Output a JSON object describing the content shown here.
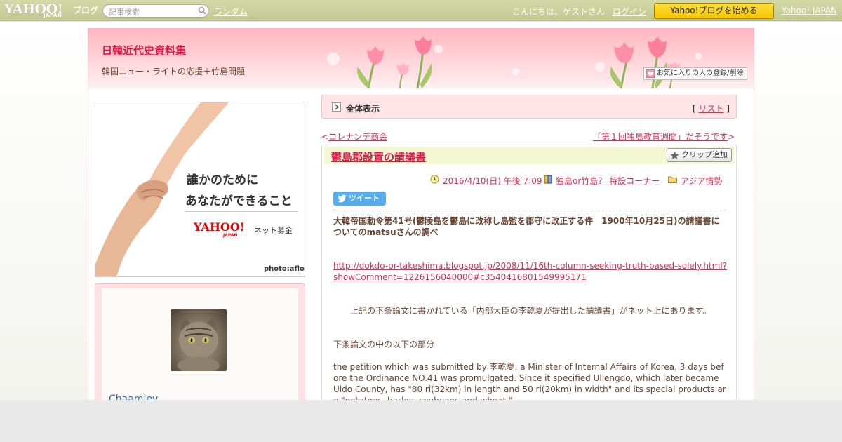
{
  "topbar": {
    "logo_main": "YAHOO!",
    "logo_sub": "JAPAN",
    "logo_blog": "ブログ",
    "search_placeholder": "記事検索",
    "random_label": "ランダム",
    "greeting": "こんにちは、ゲストさん",
    "login_label": "ログイン",
    "start_button": "Yahoo!ブログを始める",
    "yahoo_japan_link": "Yahoo! JAPAN"
  },
  "header": {
    "blog_title": "日韓近代史資料集",
    "blog_description": "韓国ニュー・ライトの応援＋竹島問題",
    "favorite_button": "お気に入りの人の登録/削除"
  },
  "sidebar": {
    "banner": {
      "line1": "誰かのために",
      "line2": "あなたができること",
      "logo": "YAHOO!",
      "logo_sub": "JAPAN",
      "bokin": "ネット募金",
      "credit": "photo:aflo"
    },
    "profile": {
      "name": "Chaamiey"
    }
  },
  "section": {
    "title": "全体表示",
    "list_open": "[ ",
    "list_label": "リスト",
    "list_close": " ]"
  },
  "nav": {
    "prev_arrow": "<",
    "prev_label": "コレナンデ商会",
    "next_label": "「第１回独島教育週間」だそうです",
    "next_arrow": ">"
  },
  "article": {
    "title": "鬱島郡設置の請議書",
    "clip_button": "クリップ追加",
    "date": "2016/4/10(日) 午後 7:09",
    "category": "独島or竹島？ 特設コーナー",
    "folder": "アジア情勢",
    "tweet_button": "ツイート",
    "paragraphs": {
      "p1": "大韓帝国勅令第41号(鬱陵島を鬱島に改称し島監を郡守に改正する件　1900年10月25日)の請議書についてのmatsuさんの調べ",
      "p2": "http://dokdo-or-takeshima.blogspot.jp/2008/11/16th-column-seeking-truth-based-solely.html?showComment=1226156040000#c3540416801549995171",
      "p3": "上記の下条論文に書かれている「内部大臣の李乾夏が提出した請議書」がネット上にあります。",
      "p4": "下条論文の中の以下の部分",
      "p5": "the petition which was submitted by 李乾夏, a Minister of Internal Affairs of Korea, 3 days before the Ordinance NO.41 was promulgated. Since it specified Ullengdo, which later became Uldo County, has \"80 ri(32km) in length and 50 ri(20km) in width\" and its special products are \"potatoes, barley, soybeans and wheat.\""
    }
  },
  "colors": {
    "accent": "#d81a4a",
    "link": "#cc3355",
    "text": "#664433",
    "topbar": "#c9ce9a",
    "start_button": "#f9cc00",
    "tweet": "#55acee"
  }
}
